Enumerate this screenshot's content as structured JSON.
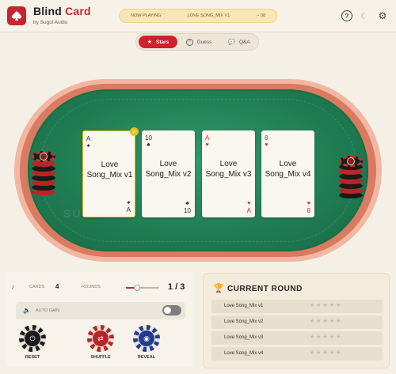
{
  "header": {
    "title_main": "Blind",
    "title_accent": "Card",
    "subtitle": "by Sugoi Audio",
    "now_playing_label": "NOW PLAYING",
    "now_playing_track": "LOVE SONG_MIX V1",
    "now_playing_time": "-- 08",
    "icons": [
      "help-icon",
      "moon-icon",
      "gear-icon"
    ]
  },
  "tabs": [
    {
      "label": "Stars",
      "icon": "star-icon",
      "active": true
    },
    {
      "label": "Guess",
      "icon": "question-icon",
      "active": false
    },
    {
      "label": "Q&A",
      "icon": "chat-icon",
      "active": false
    }
  ],
  "table": {
    "watermark_left": "SUGOI",
    "watermark_right": "SUGOI",
    "cards": [
      {
        "rank": "A",
        "suit": "♠",
        "title": "Love Song_Mix v1",
        "color": "black",
        "selected": true
      },
      {
        "rank": "10",
        "suit": "♣",
        "title": "Love Song_Mix v2",
        "color": "black",
        "selected": false
      },
      {
        "rank": "A",
        "suit": "♥",
        "title": "Love Song_Mix v3",
        "color": "red",
        "selected": false
      },
      {
        "rank": "8",
        "suit": "♥",
        "title": "Love Song_Mix v4",
        "color": "red",
        "selected": false
      }
    ]
  },
  "controls": {
    "cards_label": "CARDS",
    "cards_value": "4",
    "rounds_label": "ROUNDS",
    "rounds_value": "1 / 3",
    "rounds_progress": 0.33,
    "auto_gain_label": "AUTO GAIN",
    "auto_gain_on": false,
    "buttons": [
      {
        "label": "RESET",
        "icon": "power-icon"
      },
      {
        "label": "SHUFFLE",
        "icon": "shuffle-icon"
      },
      {
        "label": "REVEAL",
        "icon": "eye-icon"
      }
    ]
  },
  "current_round": {
    "title": "CURRENT ROUND",
    "rows": [
      {
        "name": "Love Song_Mix v1",
        "stars": "★★★★★"
      },
      {
        "name": "Love Song_Mix v2",
        "stars": "★★★★★"
      },
      {
        "name": "Love Song_Mix v3",
        "stars": "★★★★★"
      },
      {
        "name": "Love Song_Mix v4",
        "stars": "★★★★★"
      }
    ]
  },
  "colors": {
    "accent": "#c6262e",
    "felt": "#207e53",
    "rim": "#d97a61",
    "selected": "#e5c229"
  }
}
